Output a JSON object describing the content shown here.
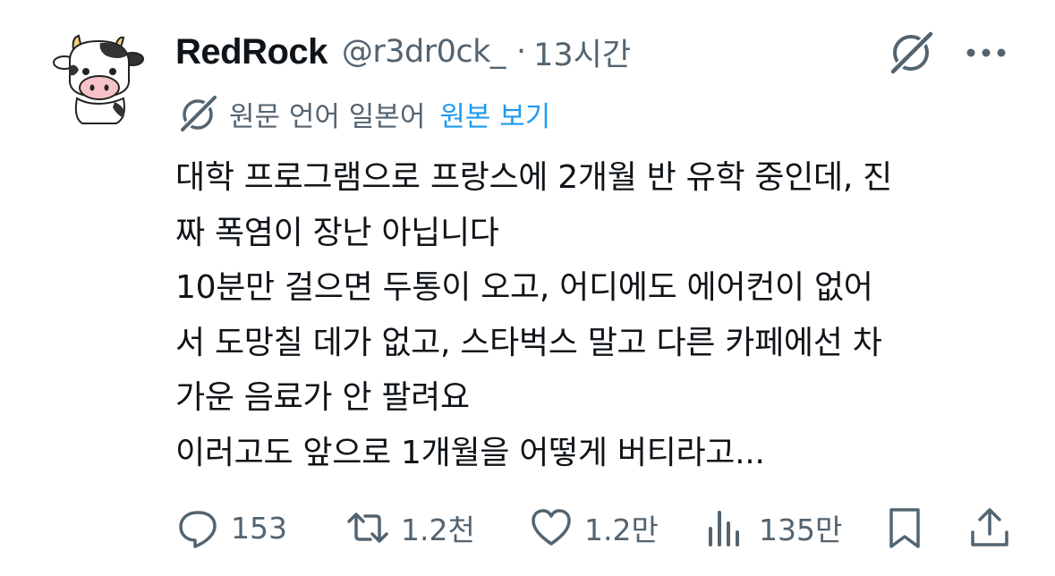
{
  "tweet": {
    "display_name": "RedRock",
    "handle": "@r3dr0ck_",
    "separator": "·",
    "time": "13시간",
    "translation": {
      "original_language": "원문 언어 일본어",
      "view_original": "원본 보기"
    },
    "text": "대학 프로그램으로 프랑스에 2개월 반 유학 중인데, 진\n짜 폭염이 장난 아닙니다\n10분만 걸으면 두통이 오고, 어디에도 에어컨이 없어\n서 도망칠 데가 없고, 스타벅스 말고 다른 카페에선 차\n가운 음료가 안 팔려요\n이러고도 앞으로 1개월을 어떻게 버티라고..."
  },
  "actions": {
    "replies": "153",
    "retweets": "1.2천",
    "likes": "1.2만",
    "views": "135만"
  },
  "colors": {
    "text_primary": "#0f1419",
    "text_secondary": "#536471",
    "link": "#1d9bf0"
  },
  "icons": [
    "cow-avatar",
    "grok-icon",
    "more-icon",
    "translate-icon",
    "reply-icon",
    "retweet-icon",
    "like-icon",
    "views-icon",
    "bookmark-icon",
    "share-icon"
  ]
}
